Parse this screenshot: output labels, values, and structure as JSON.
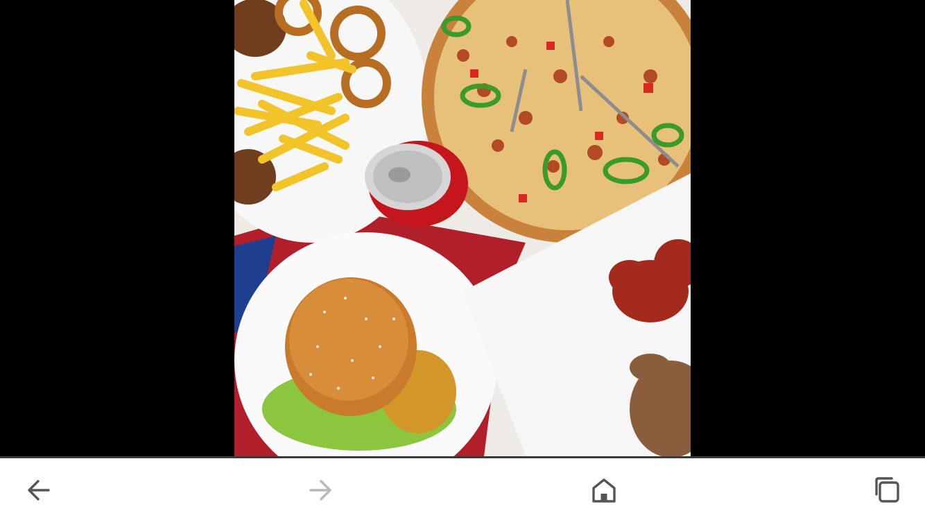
{
  "toolbar": {
    "back": {
      "icon": "arrow-left-icon",
      "enabled": true
    },
    "forward": {
      "icon": "arrow-right-icon",
      "enabled": false
    },
    "home": {
      "icon": "home-icon"
    },
    "tabs": {
      "icon": "tabs-icon"
    }
  },
  "colors": {
    "icon_active": "#555555",
    "icon_disabled": "#b8b8b8",
    "background": "#000000",
    "toolbar_bg": "#ffffff"
  }
}
